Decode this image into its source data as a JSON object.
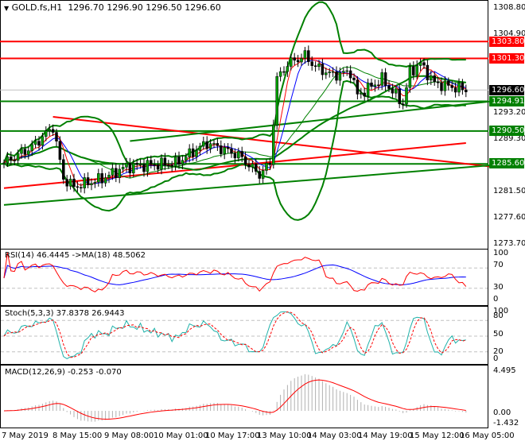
{
  "header": {
    "arrow": "▼",
    "symbol": "GOLD.fs,H1",
    "ohlc": "1296.70 1296.90 1296.50 1296.60"
  },
  "price_axis": [
    "1308.80",
    "1304.90",
    "1293.20",
    "1289.30",
    "1281.50",
    "1277.60",
    "1273.70"
  ],
  "levels": [
    {
      "price": 1303.8,
      "label": "1303.80",
      "color": "#ff0000"
    },
    {
      "price": 1301.3,
      "label": "1301.30",
      "color": "#ff0000"
    },
    {
      "price": 1294.91,
      "label": "1294.91",
      "color": "#008000"
    },
    {
      "price": 1290.5,
      "label": "1290.50",
      "color": "#008000"
    },
    {
      "price": 1285.6,
      "label": "1285.60",
      "color": "#008000"
    }
  ],
  "current_price": {
    "price": 1296.6,
    "label": "1296.60",
    "color": "#000000"
  },
  "trendlines": [
    {
      "from": [
        14,
        1292.6
      ],
      "to": [
        139,
        1285.2
      ],
      "color": "#ff0000"
    },
    {
      "from": [
        0,
        1282.0
      ],
      "to": [
        132,
        1288.7
      ],
      "color": "#ff0000"
    },
    {
      "from": [
        0,
        1279.5
      ],
      "to": [
        139,
        1285.4
      ],
      "color": "#008000"
    },
    {
      "from": [
        36,
        1289.0
      ],
      "to": [
        139,
        1294.9
      ],
      "color": "#008000"
    }
  ],
  "price_path": [
    [
      0,
      1285.75
    ],
    [
      8,
      1288.1
    ],
    [
      14,
      1291.1
    ],
    [
      17,
      1283.4
    ],
    [
      20,
      1282.2
    ],
    [
      28,
      1283.4
    ],
    [
      35,
      1285.2
    ],
    [
      49,
      1285.7
    ],
    [
      58,
      1288.7
    ],
    [
      67,
      1286.9
    ],
    [
      73,
      1284.0
    ],
    [
      76,
      1285.7
    ],
    [
      78,
      1298.2
    ],
    [
      81,
      1300.5
    ],
    [
      86,
      1301.7
    ],
    [
      89,
      1300.0
    ],
    [
      94,
      1298.8
    ],
    [
      99,
      1299.3
    ],
    [
      101,
      1295.8
    ],
    [
      108,
      1298.2
    ],
    [
      114,
      1294.6
    ],
    [
      116,
      1299.3
    ],
    [
      119,
      1300.5
    ],
    [
      123,
      1297.6
    ],
    [
      132,
      1296.6
    ]
  ],
  "rsi": {
    "label": "RSI(14) 46.4445   ->MA(18) 48.5062",
    "axis": [
      "100",
      "70",
      "30",
      "0"
    ]
  },
  "stoch": {
    "label": "Stoch(5,3,3) 37.8378 26.9443",
    "axis": [
      "100",
      "80",
      "50",
      "20",
      "0"
    ]
  },
  "macd": {
    "label": "MACD(12,26,9) -0.253 -0.070",
    "axis": [
      "4.495",
      "0.00",
      "-1.432"
    ]
  },
  "time_axis": [
    "7 May 2019",
    "8 May 15:00",
    "9 May 08:00",
    "10 May 01:00",
    "10 May 17:00",
    "13 May 10:00",
    "14 May 03:00",
    "14 May 19:00",
    "15 May 12:00",
    "16 May 05:00"
  ]
}
